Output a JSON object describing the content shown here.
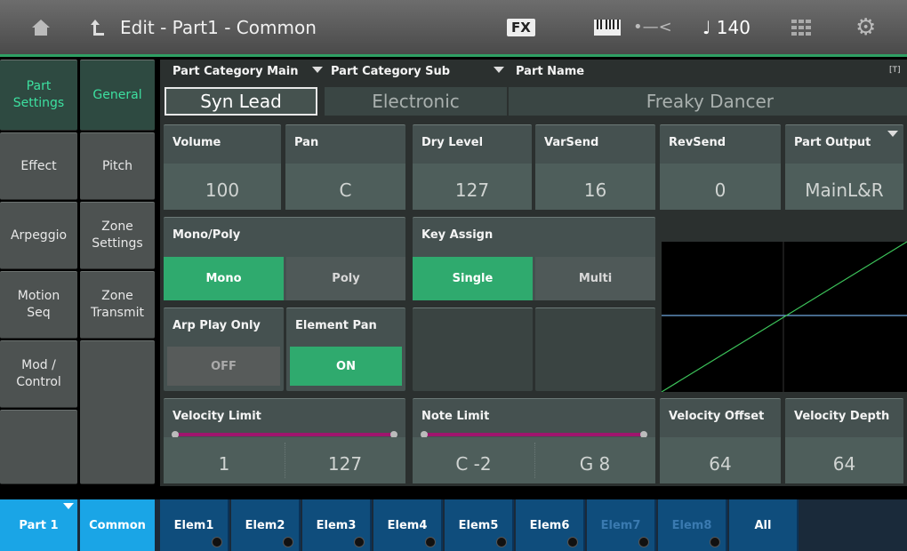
{
  "topbar": {
    "title": "Edit - Part1 - Common",
    "fx_label": "FX",
    "tempo": "♩ 140",
    "icons": [
      "home-icon",
      "back-icon",
      "keyboard-icon",
      "usb-icon",
      "grid-icon",
      "gear-icon"
    ]
  },
  "nav": {
    "col1": [
      "Part\nSettings",
      "Effect",
      "Arpeggio",
      "Motion\nSeq",
      "Mod /\nControl"
    ],
    "col2": [
      "General",
      "Pitch",
      "Zone\nSettings",
      "Zone\nTransmit"
    ]
  },
  "part": {
    "category_main_label": "Part Category Main",
    "category_main_value": "Syn Lead",
    "category_sub_label": "Part Category Sub",
    "category_sub_value": "Electronic",
    "name_label": "Part Name",
    "name_value": "Freaky Dancer",
    "name_edit_icon": "[T]"
  },
  "params": [
    {
      "label": "Volume",
      "value": "100"
    },
    {
      "label": "Pan",
      "value": "C"
    },
    {
      "label": "Dry Level",
      "value": "127"
    },
    {
      "label": "VarSend",
      "value": "16"
    },
    {
      "label": "RevSend",
      "value": "0"
    },
    {
      "label": "Part Output",
      "value": "MainL&R"
    }
  ],
  "mono_poly": {
    "label": "Mono/Poly",
    "options": [
      "Mono",
      "Poly"
    ],
    "selected": "Mono"
  },
  "key_assign": {
    "label": "Key Assign",
    "options": [
      "Single",
      "Multi"
    ],
    "selected": "Single"
  },
  "arp_play_only": {
    "label": "Arp Play Only",
    "value": "OFF"
  },
  "element_pan": {
    "label": "Element Pan",
    "value": "ON"
  },
  "velocity_limit": {
    "label": "Velocity Limit",
    "low": "1",
    "high": "127"
  },
  "note_limit": {
    "label": "Note Limit",
    "low": "C -2",
    "high": "G 8"
  },
  "velocity_offset": {
    "label": "Velocity Offset",
    "value": "64"
  },
  "velocity_depth": {
    "label": "Velocity Depth",
    "value": "64"
  },
  "bottom": {
    "part": "Part 1",
    "common": "Common",
    "elements": [
      "Elem1",
      "Elem2",
      "Elem3",
      "Elem4",
      "Elem5",
      "Elem6",
      "Elem7",
      "Elem8",
      "All"
    ]
  },
  "colors": {
    "accent_green": "#2faa6e",
    "accent_blue": "#1aa5e6",
    "curve_green": "#3cc35a",
    "curve_blue": "#6fa8e0",
    "limit_bar": "#a0156e"
  }
}
